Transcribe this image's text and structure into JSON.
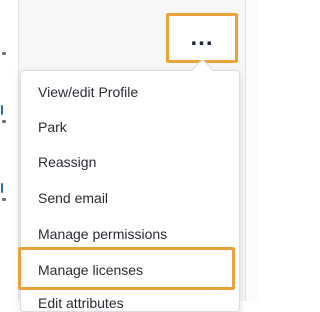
{
  "toolbar": {
    "more_label": "..."
  },
  "menu": {
    "items": [
      {
        "label": "View/edit Profile"
      },
      {
        "label": "Park"
      },
      {
        "label": "Reassign"
      },
      {
        "label": "Send email"
      },
      {
        "label": "Manage permissions"
      },
      {
        "label": "Manage licenses"
      },
      {
        "label": "Edit attributes"
      }
    ]
  },
  "colors": {
    "highlight": "#e8a33a",
    "text": "#2c2c34",
    "link": "#2b6cb0"
  }
}
